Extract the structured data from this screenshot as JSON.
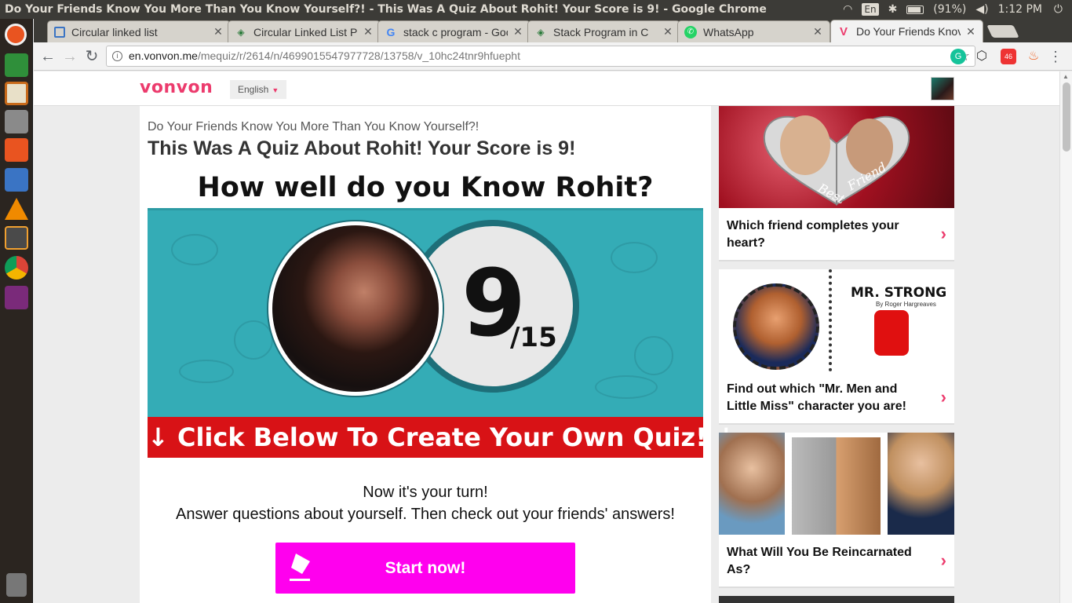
{
  "window": {
    "title": "Do Your Friends Know You More Than You Know Yourself?! - This Was A Quiz About Rohit! Your Score is 9! - Google Chrome"
  },
  "tray": {
    "keyboard": "En",
    "battery": "(91%)",
    "time": "1:12 PM"
  },
  "tabs": [
    {
      "label": "Circular linked list",
      "icon": "page-icon"
    },
    {
      "label": "Circular Linked List P",
      "icon": "diamond-icon"
    },
    {
      "label": "stack c program - Goo",
      "icon": "google-icon"
    },
    {
      "label": "Stack Program in C",
      "icon": "diamond-icon"
    },
    {
      "label": "WhatsApp",
      "icon": "whatsapp-icon"
    },
    {
      "label": "Do Your Friends Knov",
      "icon": "vonvon-icon"
    }
  ],
  "omnibox": {
    "host": "en.vonvon.me",
    "path": "/mequiz/r/2614/n/4699015547977728/13758/v_10hc24tnr9hfuepht"
  },
  "extensions": {
    "badge": "46"
  },
  "site": {
    "logo": "vonvon",
    "language": "English"
  },
  "quiz": {
    "subtitle": "Do Your Friends Know You More Than You Know Yourself?!",
    "heading": "This Was A Quiz About Rohit! Your Score is 9!",
    "banner_title": "How well do you Know Rohit?",
    "score": "9",
    "score_total": "/15",
    "create_banner": "↓ Click Below To Create Your Own Quiz! ↓",
    "turn_line1": "Now it's your turn!",
    "turn_line2": "Answer questions about yourself. Then check out your friends' answers!",
    "start_label": "Start now!"
  },
  "sidebar": [
    {
      "title": "Which friend completes your heart?"
    },
    {
      "title": "Find out which \"Mr. Men and Little Miss\" character you are!",
      "img_text": "MR. STRONG",
      "img_sub": "By Roger Hargreaves"
    },
    {
      "title": "What Will You Be Reincarnated As?"
    }
  ],
  "heart_words": {
    "left": "Best",
    "right": "Friend"
  },
  "colors": {
    "brand": "#ec3b6d",
    "teal": "#34acb6",
    "red_banner": "#d81216",
    "start_button": "#ff00ee"
  }
}
